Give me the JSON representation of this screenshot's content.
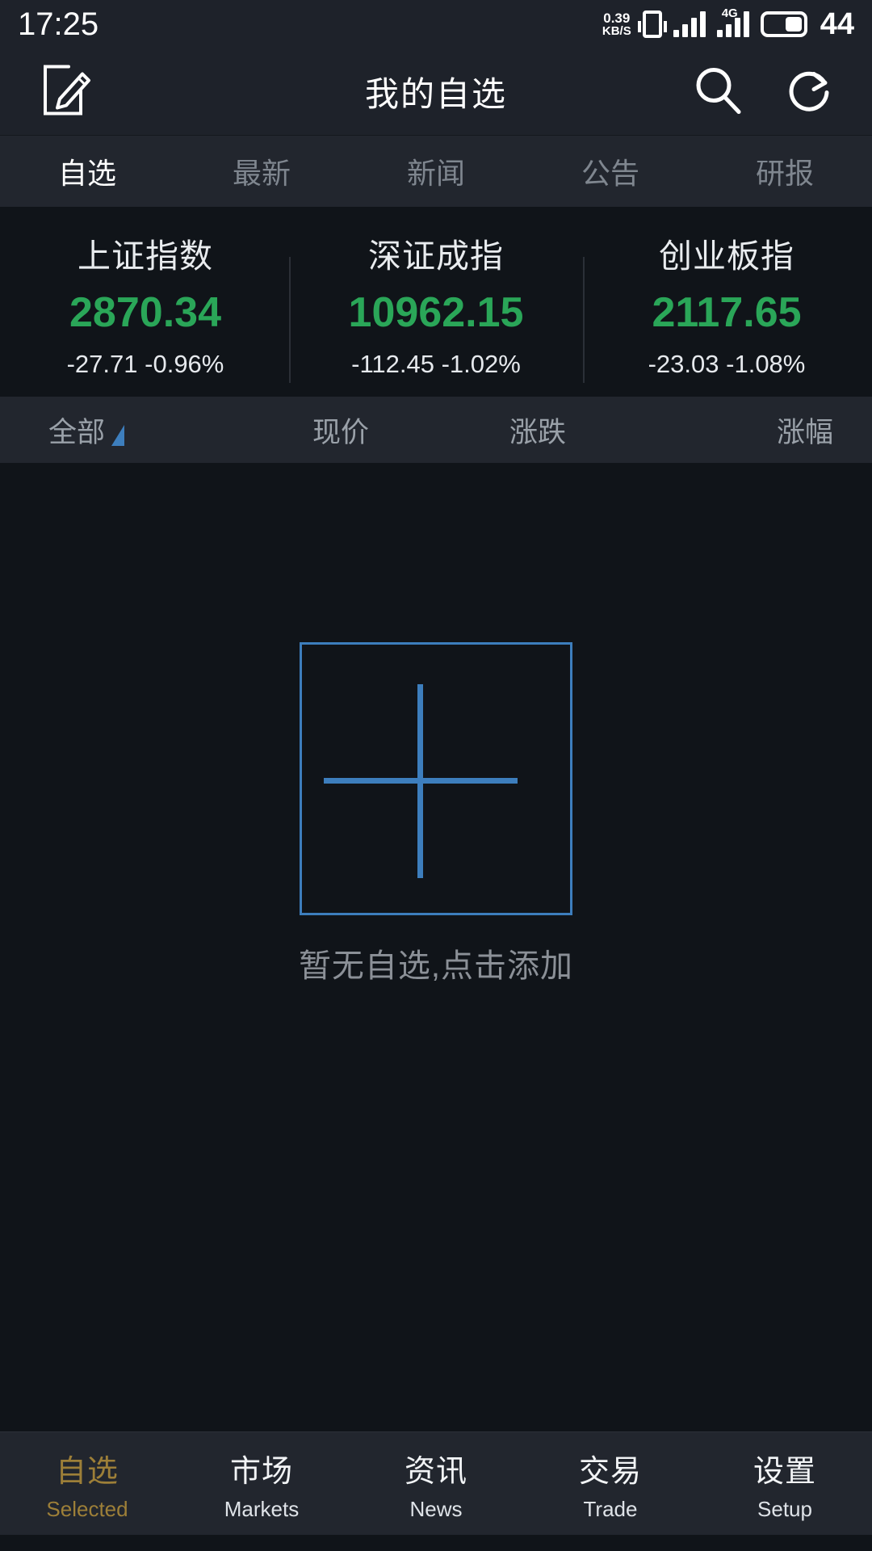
{
  "status_bar": {
    "time": "17:25",
    "net_speed_value": "0.39",
    "net_speed_unit": "KB/S",
    "network_type": "4G",
    "battery_level": "44"
  },
  "title_bar": {
    "title": "我的自选",
    "edit_icon": "edit-icon",
    "search_icon": "search-icon",
    "refresh_icon": "refresh-icon"
  },
  "tabs": [
    {
      "label": "自选",
      "active": true
    },
    {
      "label": "最新",
      "active": false
    },
    {
      "label": "新闻",
      "active": false
    },
    {
      "label": "公告",
      "active": false
    },
    {
      "label": "研报",
      "active": false
    }
  ],
  "indices": [
    {
      "name": "上证指数",
      "value": "2870.34",
      "change": "-27.71",
      "percent": "-0.96%"
    },
    {
      "name": "深证成指",
      "value": "10962.15",
      "change": "-112.45",
      "percent": "-1.02%"
    },
    {
      "name": "创业板指",
      "value": "2117.65",
      "change": "-23.03",
      "percent": "-1.08%"
    }
  ],
  "sort_bar": {
    "filter_label": "全部",
    "columns": [
      "现价",
      "涨跌",
      "涨幅"
    ]
  },
  "empty_state": {
    "message": "暂无自选,点击添加",
    "add_icon": "plus-icon"
  },
  "bottom_nav": [
    {
      "cn": "自选",
      "en": "Selected",
      "active": true
    },
    {
      "cn": "市场",
      "en": "Markets",
      "active": false
    },
    {
      "cn": "资讯",
      "en": "News",
      "active": false
    },
    {
      "cn": "交易",
      "en": "Trade",
      "active": false
    },
    {
      "cn": "设置",
      "en": "Setup",
      "active": false
    }
  ],
  "colors": {
    "down_green": "#2aa658",
    "accent_blue": "#3d7ebd",
    "active_gold": "#9d7f38",
    "bar_background": "#22262e",
    "page_background": "#101419"
  }
}
